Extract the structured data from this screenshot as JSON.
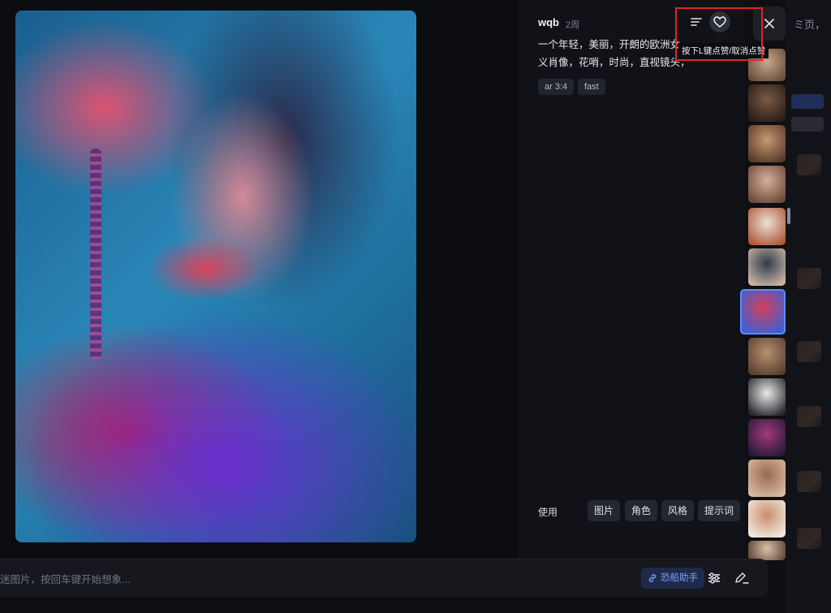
{
  "background_page": {
    "text": "ミ页，"
  },
  "post": {
    "author": "wqb",
    "time_ago": "2周",
    "prompt_line1": "一个年轻，美丽，开朗的欧洲女",
    "prompt_line2": "义肖像，花哨，时尚，直视镜头，",
    "tags": [
      "ar 3:4",
      "fast"
    ]
  },
  "toolbar": {
    "like_tooltip": "按下L键点赞/取消点赞"
  },
  "use_section": {
    "label": "使用",
    "buttons": [
      "图片",
      "角色",
      "风格",
      "提示词"
    ]
  },
  "input_bar": {
    "placeholder": "迷图片，按回车键开始想象...",
    "assist_label": "恐船助手"
  },
  "thumbnails": [
    {
      "name": "thumb-1",
      "colors": [
        "#caa98a",
        "#6a4f3c"
      ]
    },
    {
      "name": "thumb-2",
      "colors": [
        "#7a5a46",
        "#2b1e18"
      ]
    },
    {
      "name": "thumb-3",
      "colors": [
        "#c79a73",
        "#5a3a2a"
      ]
    },
    {
      "name": "thumb-4",
      "colors": [
        "#d7b09a",
        "#6e4a3a"
      ]
    },
    {
      "name": "thumb-5",
      "colors": [
        "#e9e2d8",
        "#b05a3a"
      ]
    },
    {
      "name": "thumb-6",
      "colors": [
        "#2e3a4a",
        "#c9b3a5"
      ]
    },
    {
      "name": "thumb-7",
      "colors": [
        "#d2405c",
        "#3f5fd0"
      ]
    },
    {
      "name": "thumb-8",
      "colors": [
        "#b89070",
        "#5b4030"
      ]
    },
    {
      "name": "thumb-9",
      "colors": [
        "#eceae8",
        "#2a2b30"
      ]
    },
    {
      "name": "thumb-10",
      "colors": [
        "#a03a7a",
        "#2a1a3a"
      ]
    },
    {
      "name": "thumb-11",
      "colors": [
        "#9a6a50",
        "#d8b8a0"
      ]
    },
    {
      "name": "thumb-12",
      "colors": [
        "#c98e6a",
        "#f2e8e0"
      ]
    },
    {
      "name": "thumb-13",
      "colors": [
        "#d8c0a8",
        "#6a5040"
      ]
    }
  ],
  "colors": {
    "accent": "#5b8cff",
    "highlight_box": "#e1242c"
  }
}
